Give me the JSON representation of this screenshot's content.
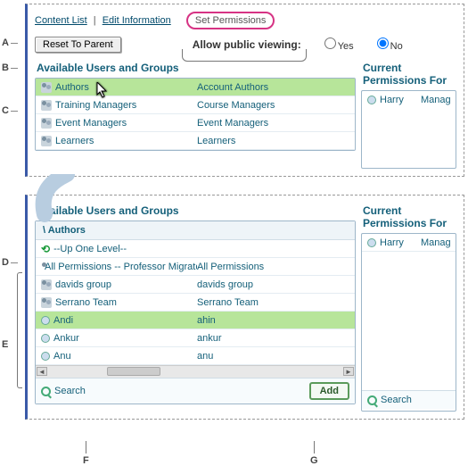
{
  "labels": {
    "A": "A",
    "B": "B",
    "C": "C",
    "D": "D",
    "E": "E",
    "F": "F",
    "G": "G"
  },
  "tabs": {
    "content_list": "Content List",
    "edit_info": "Edit Information",
    "set_perm": "Set Permissions"
  },
  "toolbar": {
    "reset": "Reset To Parent",
    "allow_label": "Allow public viewing:",
    "yes": "Yes",
    "no": "No"
  },
  "panel1": {
    "left_head": "Available Users and Groups",
    "right_head": "Current Permissions For",
    "rows": [
      {
        "name": "Authors",
        "desc": "Account Authors",
        "sel": true
      },
      {
        "name": "Training Managers",
        "desc": "Course Managers",
        "sel": false
      },
      {
        "name": "Event Managers",
        "desc": "Event Managers",
        "sel": false
      },
      {
        "name": "Learners",
        "desc": "Learners",
        "sel": false
      }
    ],
    "right_rows": [
      {
        "name": "Harry",
        "desc": "Manag"
      }
    ]
  },
  "panel2": {
    "left_head": "Available Users and Groups",
    "right_head": "Current Permissions For",
    "crumb": "\\ Authors",
    "up": "--Up One Level--",
    "rows": [
      {
        "type": "group",
        "name": "All Permissions -- Professor Migrated Users",
        "desc": "All Permissions",
        "sel": false
      },
      {
        "type": "group",
        "name": "davids group",
        "desc": "davids group",
        "sel": false
      },
      {
        "type": "group",
        "name": "Serrano Team",
        "desc": "Serrano Team",
        "sel": false
      },
      {
        "type": "user",
        "name": "Andi",
        "desc": "ahin",
        "sel": true
      },
      {
        "type": "user",
        "name": "Ankur",
        "desc": "ankur",
        "sel": false
      },
      {
        "type": "user",
        "name": "Anu",
        "desc": "anu",
        "sel": false
      }
    ],
    "search": "Search",
    "add": "Add",
    "right_rows": [
      {
        "name": "Harry",
        "desc": "Manag"
      }
    ],
    "right_search": "Search"
  }
}
